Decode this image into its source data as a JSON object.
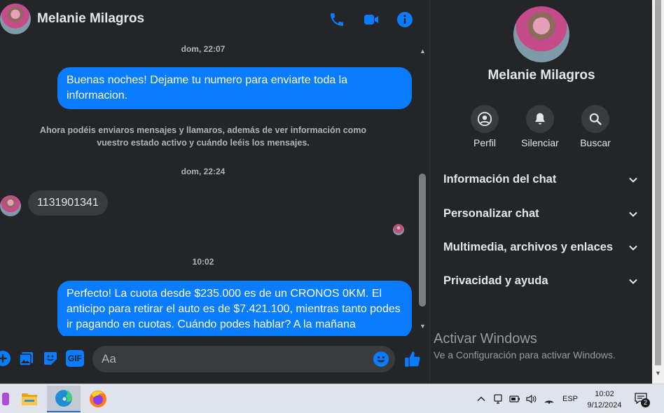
{
  "header": {
    "name": "Melanie Milagros"
  },
  "messages": [
    {
      "type": "timestamp",
      "text": "dom, 22:07"
    },
    {
      "type": "outgoing",
      "text": "Buenas noches! Dejame tu numero para enviarte toda la informacion."
    },
    {
      "type": "notice",
      "text": "Ahora podéis enviaros mensajes y llamaros, además de ver información como vuestro estado activo y cuándo leéis los mensajes."
    },
    {
      "type": "timestamp",
      "text": "dom, 22:24"
    },
    {
      "type": "incoming",
      "text": "1131901341"
    },
    {
      "type": "timestamp",
      "text": "10:02"
    },
    {
      "type": "outgoing",
      "text": "Perfecto! La cuota desde $235.000 es de un CRONOS 0KM. El anticipo para retirar el auto es de $7.421.100, mientras tanto podes ir pagando en cuotas. Cuándo podes hablar? A la mañana"
    }
  ],
  "composer": {
    "placeholder": "Aa",
    "gif_label": "GIF"
  },
  "info_panel": {
    "name": "Melanie Milagros",
    "actions": [
      {
        "label": "Perfil",
        "icon": "profile-icon"
      },
      {
        "label": "Silenciar",
        "icon": "bell-icon"
      },
      {
        "label": "Buscar",
        "icon": "search-icon"
      }
    ],
    "sections": [
      {
        "label": "Información del chat"
      },
      {
        "label": "Personalizar chat"
      },
      {
        "label": "Multimedia, archivos y enlaces"
      },
      {
        "label": "Privacidad y ayuda"
      }
    ]
  },
  "watermark": {
    "title": "Activar Windows",
    "subtitle": "Ve a Configuración para activar Windows."
  },
  "taskbar": {
    "language": "ESP",
    "time": "10:02",
    "date": "9/12/2024",
    "notification_count": "2"
  },
  "colors": {
    "accent": "#0a7cff",
    "background": "#242526",
    "bubble_in": "#3a3b3c"
  }
}
